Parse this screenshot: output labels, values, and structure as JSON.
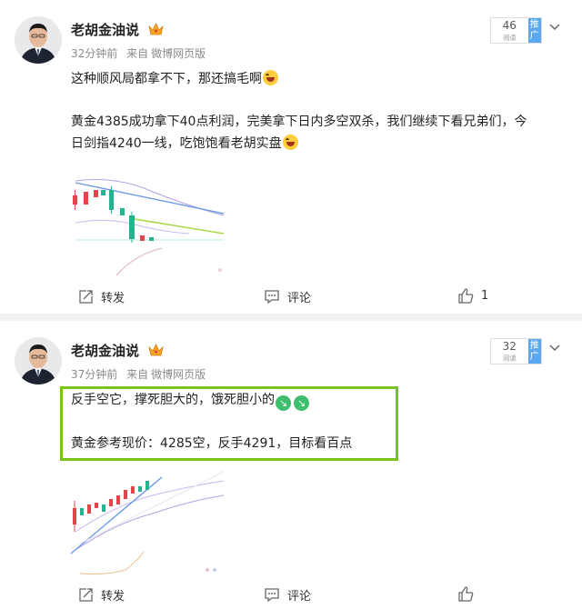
{
  "posts": [
    {
      "author": "老胡金油说",
      "time": "32分钟前",
      "source_prefix": "来自",
      "source": "微博网页版",
      "reads": "46",
      "reads_label": "阅读",
      "push_label": "推广",
      "line1": "这种顺风局都拿不下，那还搞毛啊",
      "line2": "黄金4385成功拿下40点利润，完美拿下日内多空双杀，我们继续下看兄弟们，今",
      "line3": "日剑指4240一线，吃饱饱看老胡实盘",
      "repost_label": "转发",
      "comment_label": "评论",
      "like_count": "1"
    },
    {
      "author": "老胡金油说",
      "time": "37分钟前",
      "source_prefix": "来自",
      "source": "微博网页版",
      "reads": "32",
      "reads_label": "阅读",
      "push_label": "推广",
      "line1": "反手空它，撑死胆大的，饿死胆小的",
      "line2": "黄金参考现价：4285空，反手4291，目标看百点",
      "repost_label": "转发",
      "comment_label": "评论"
    }
  ],
  "colors": {
    "accent_green": "#7cc21d",
    "push_blue": "#5ba8f0",
    "candle_red": "#e0464a",
    "candle_green": "#24b38f"
  },
  "icons": {
    "crown": "crown-badge-icon",
    "chevron": "chevron-down-icon",
    "repost": "repost-icon",
    "comment": "comment-icon",
    "like": "thumbs-up-icon"
  }
}
